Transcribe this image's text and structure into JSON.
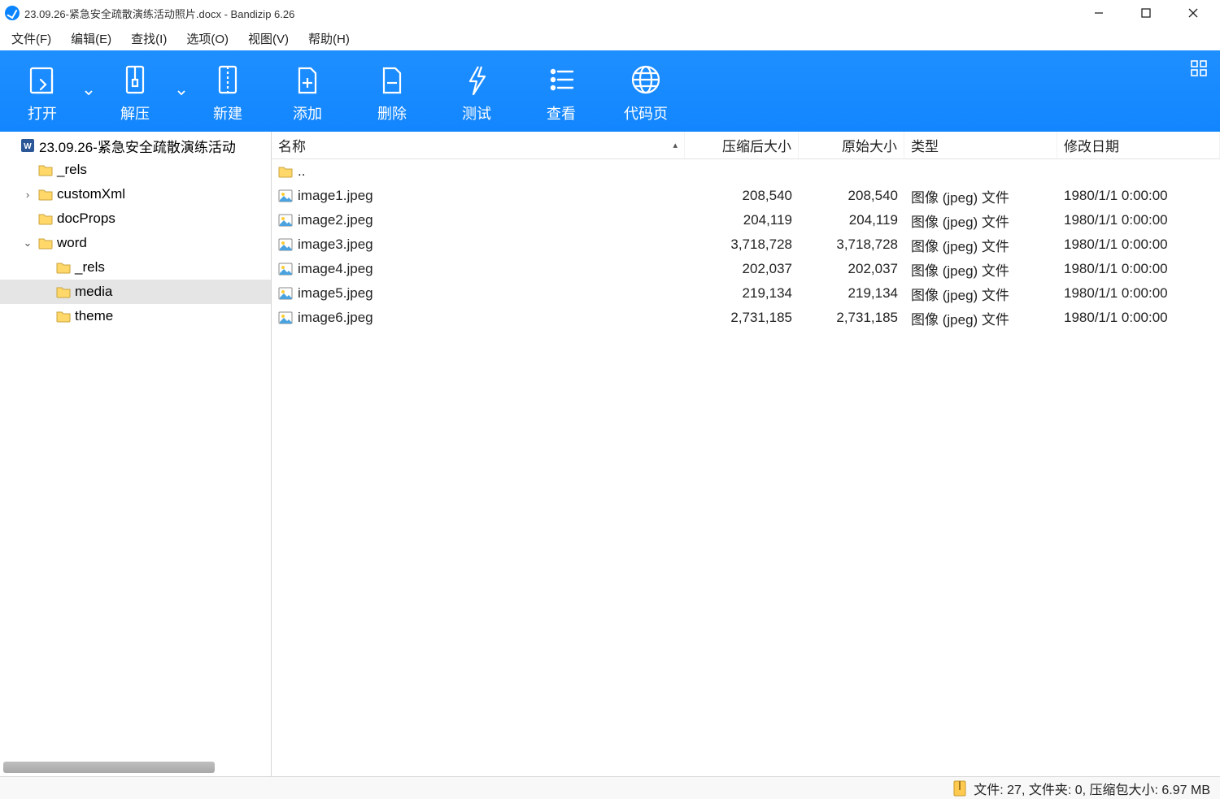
{
  "window": {
    "title": "23.09.26-紧急安全疏散演练活动照片.docx - Bandizip 6.26"
  },
  "menu": {
    "file": "文件(F)",
    "edit": "编辑(E)",
    "find": "查找(I)",
    "options": "选项(O)",
    "view": "视图(V)",
    "help": "帮助(H)"
  },
  "toolbar": {
    "open": "打开",
    "extract": "解压",
    "new": "新建",
    "add": "添加",
    "delete": "删除",
    "test": "测试",
    "view": "查看",
    "codepage": "代码页"
  },
  "tree": {
    "root": "23.09.26-紧急安全疏散演练活动",
    "items": [
      {
        "name": "_rels",
        "indent": 1
      },
      {
        "name": "customXml",
        "indent": 1,
        "expander": "›"
      },
      {
        "name": "docProps",
        "indent": 1
      },
      {
        "name": "word",
        "indent": 1,
        "expander": "⌄",
        "expanded": true
      },
      {
        "name": "_rels",
        "indent": 2
      },
      {
        "name": "media",
        "indent": 2,
        "selected": true
      },
      {
        "name": "theme",
        "indent": 2
      }
    ]
  },
  "columns": {
    "name": "名称",
    "packed": "压缩后大小",
    "orig": "原始大小",
    "type": "类型",
    "date": "修改日期"
  },
  "parent": "..",
  "files": [
    {
      "name": "image1.jpeg",
      "packed": "208,540",
      "orig": "208,540",
      "type": "图像 (jpeg) 文件",
      "date": "1980/1/1 0:00:00"
    },
    {
      "name": "image2.jpeg",
      "packed": "204,119",
      "orig": "204,119",
      "type": "图像 (jpeg) 文件",
      "date": "1980/1/1 0:00:00"
    },
    {
      "name": "image3.jpeg",
      "packed": "3,718,728",
      "orig": "3,718,728",
      "type": "图像 (jpeg) 文件",
      "date": "1980/1/1 0:00:00"
    },
    {
      "name": "image4.jpeg",
      "packed": "202,037",
      "orig": "202,037",
      "type": "图像 (jpeg) 文件",
      "date": "1980/1/1 0:00:00"
    },
    {
      "name": "image5.jpeg",
      "packed": "219,134",
      "orig": "219,134",
      "type": "图像 (jpeg) 文件",
      "date": "1980/1/1 0:00:00"
    },
    {
      "name": "image6.jpeg",
      "packed": "2,731,185",
      "orig": "2,731,185",
      "type": "图像 (jpeg) 文件",
      "date": "1980/1/1 0:00:00"
    }
  ],
  "status": {
    "text": "文件: 27, 文件夹: 0, 压缩包大小: 6.97 MB"
  }
}
